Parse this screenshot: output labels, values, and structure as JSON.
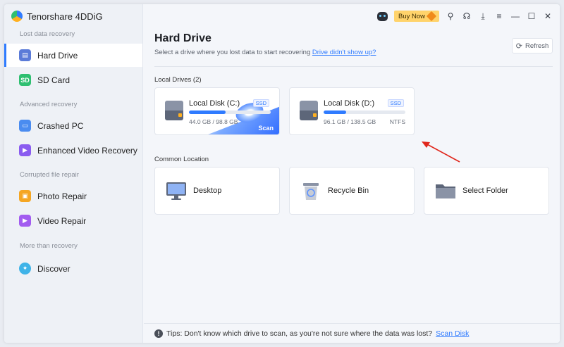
{
  "app": {
    "title": "Tenorshare 4DDiG"
  },
  "sidebar": {
    "sections": [
      {
        "label": "Lost data recovery"
      },
      {
        "label": "Advanced recovery"
      },
      {
        "label": "Corrupted file repair"
      },
      {
        "label": "More than recovery"
      }
    ],
    "items": [
      {
        "label": "Hard Drive",
        "icon": "hard-drive-icon",
        "active": true
      },
      {
        "label": "SD Card",
        "icon": "sd-card-icon"
      },
      {
        "label": "Crashed PC",
        "icon": "crashed-pc-icon"
      },
      {
        "label": "Enhanced Video Recovery",
        "icon": "video-recovery-icon"
      },
      {
        "label": "Photo Repair",
        "icon": "photo-repair-icon"
      },
      {
        "label": "Video Repair",
        "icon": "video-repair-icon"
      },
      {
        "label": "Discover",
        "icon": "discover-icon"
      }
    ]
  },
  "topbar": {
    "buy_label": "Buy Now"
  },
  "main": {
    "title": "Hard Drive",
    "subtitle": "Select a drive where you lost data to start recovering",
    "subtitle_link": "Drive didn't show up?",
    "refresh_label": "Refresh",
    "local_drives_label": "Local Drives (2)",
    "drives": [
      {
        "name": "Local Disk (C:)",
        "badge": "SSD",
        "size": "44.0 GB / 98.8 GB",
        "used_fraction": 0.445,
        "fs": "",
        "scan_label": "Scan"
      },
      {
        "name": "Local Disk (D:)",
        "badge": "SSD",
        "size": "96.1 GB / 138.5 GB",
        "used_fraction": 0.277,
        "fs": "NTFS"
      }
    ],
    "common_location_label": "Common Location",
    "locations": [
      {
        "label": "Desktop",
        "icon": "desktop-icon"
      },
      {
        "label": "Recycle Bin",
        "icon": "recycle-bin-icon"
      },
      {
        "label": "Select Folder",
        "icon": "folder-icon"
      }
    ]
  },
  "tips": {
    "text": "Tips: Don't know which drive to scan, as you're not sure where the data was lost?",
    "link": "Scan Disk"
  },
  "colors": {
    "accent": "#2f7bff",
    "buy": "#ffd36b"
  }
}
